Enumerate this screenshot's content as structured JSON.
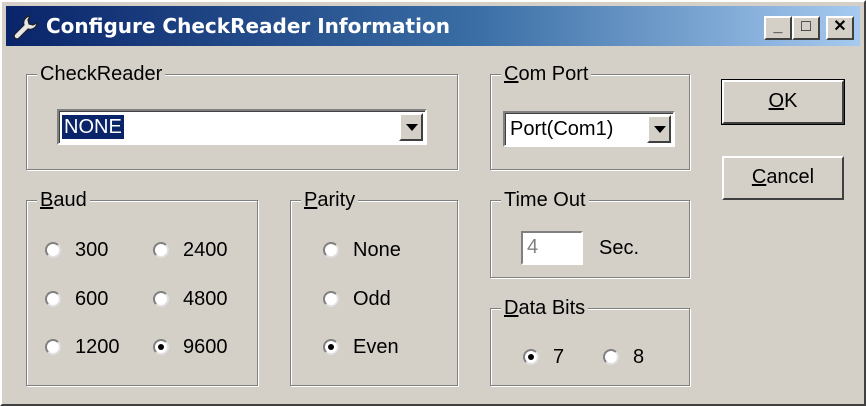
{
  "window": {
    "title": "Configure CheckReader Information",
    "icon": "wrench-icon",
    "controls": {
      "minimize": "_",
      "maximize": "□",
      "close": "✕"
    }
  },
  "checkreader": {
    "label": "CheckReader",
    "value": "NONE"
  },
  "com_port": {
    "label_accel": "C",
    "label_rest": "om Port",
    "value": "Port(Com1)"
  },
  "buttons": {
    "ok_accel": "O",
    "ok_rest": "K",
    "cancel_accel": "C",
    "cancel_rest": "ancel"
  },
  "baud": {
    "label_accel": "B",
    "label_rest": "aud",
    "options": [
      {
        "label": "300",
        "selected": false
      },
      {
        "label": "2400",
        "selected": false
      },
      {
        "label": "600",
        "selected": false
      },
      {
        "label": "4800",
        "selected": false
      },
      {
        "label": "1200",
        "selected": false
      },
      {
        "label": "9600",
        "selected": true
      }
    ]
  },
  "parity": {
    "label_accel": "P",
    "label_rest": "arity",
    "options": [
      {
        "label": "None",
        "selected": false
      },
      {
        "label": "Odd",
        "selected": false
      },
      {
        "label": "Even",
        "selected": true
      }
    ]
  },
  "time_out": {
    "label": "Time Out",
    "value": "4",
    "unit": "Sec."
  },
  "data_bits": {
    "label_accel": "D",
    "label_rest": "ata Bits",
    "options": [
      {
        "label": "7",
        "selected": true
      },
      {
        "label": "8",
        "selected": false
      }
    ]
  }
}
